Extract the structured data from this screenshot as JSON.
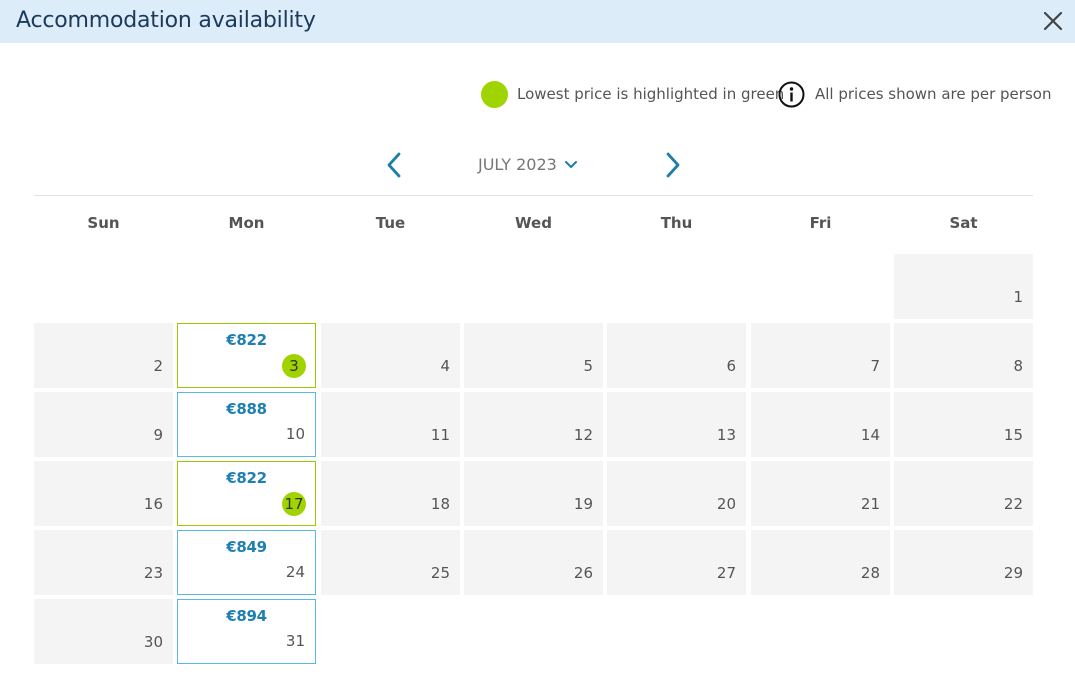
{
  "header": {
    "title": "Accommodation availability"
  },
  "legend": {
    "lowest_label": "Lowest price is highlighted in green",
    "info_label": "All prices shown are per person"
  },
  "nav": {
    "month": "JULY 2023"
  },
  "colors": {
    "lowest": "#9fd400",
    "available_border": "#5bb8e0",
    "price": "#1e7fb3",
    "header_bg": "#dcecf9"
  },
  "calendar": {
    "weekdays": [
      "Sun",
      "Mon",
      "Tue",
      "Wed",
      "Thu",
      "Fri",
      "Sat"
    ],
    "days": [
      {
        "d": "1"
      },
      {
        "d": "2"
      },
      {
        "d": "3",
        "price": "€822",
        "lowest": true
      },
      {
        "d": "4"
      },
      {
        "d": "5"
      },
      {
        "d": "6"
      },
      {
        "d": "7"
      },
      {
        "d": "8"
      },
      {
        "d": "9"
      },
      {
        "d": "10",
        "price": "€888"
      },
      {
        "d": "11"
      },
      {
        "d": "12"
      },
      {
        "d": "13"
      },
      {
        "d": "14"
      },
      {
        "d": "15"
      },
      {
        "d": "16"
      },
      {
        "d": "17",
        "price": "€822",
        "lowest": true
      },
      {
        "d": "18"
      },
      {
        "d": "19"
      },
      {
        "d": "20"
      },
      {
        "d": "21"
      },
      {
        "d": "22"
      },
      {
        "d": "23"
      },
      {
        "d": "24",
        "price": "€849"
      },
      {
        "d": "25"
      },
      {
        "d": "26"
      },
      {
        "d": "27"
      },
      {
        "d": "28"
      },
      {
        "d": "29"
      },
      {
        "d": "30"
      },
      {
        "d": "31",
        "price": "€894"
      }
    ]
  }
}
